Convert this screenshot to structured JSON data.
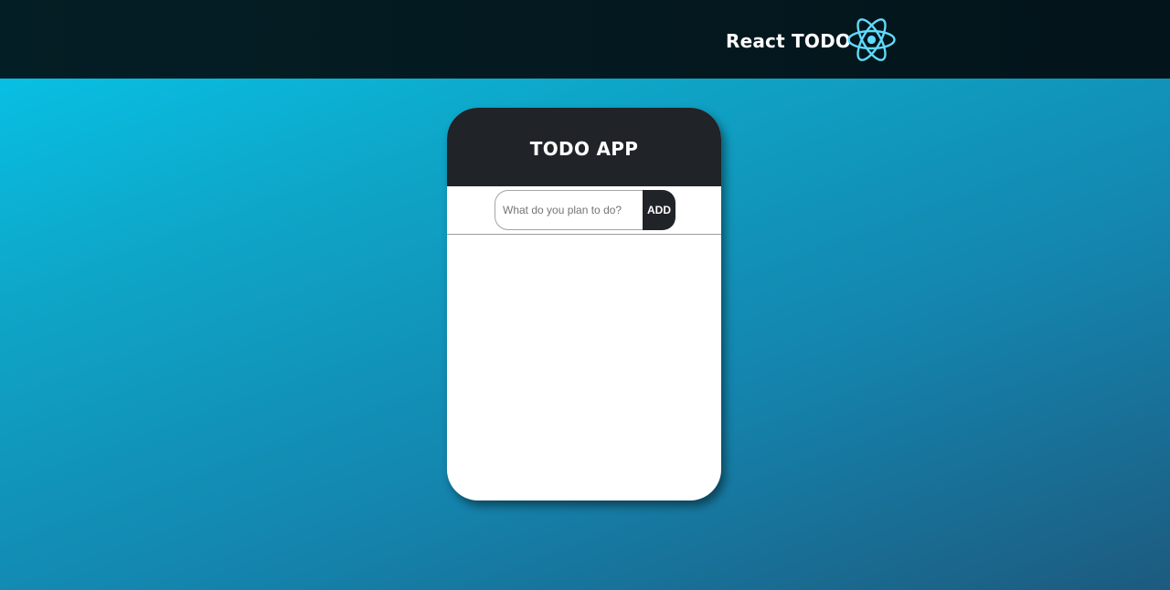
{
  "navbar": {
    "brand_title": "React TODO",
    "logo_icon": "react-atom-icon",
    "logo_color": "#61dafb"
  },
  "todo_card": {
    "title": "TODO APP",
    "input": {
      "value": "",
      "placeholder": "What do you plan to do?"
    },
    "add_button_label": "ADD",
    "items": []
  },
  "colors": {
    "navbar_bg": "#03141a",
    "card_header_bg": "#202328",
    "background_gradient_start": "#06c8ec",
    "background_gradient_end": "#1d5a7f"
  }
}
